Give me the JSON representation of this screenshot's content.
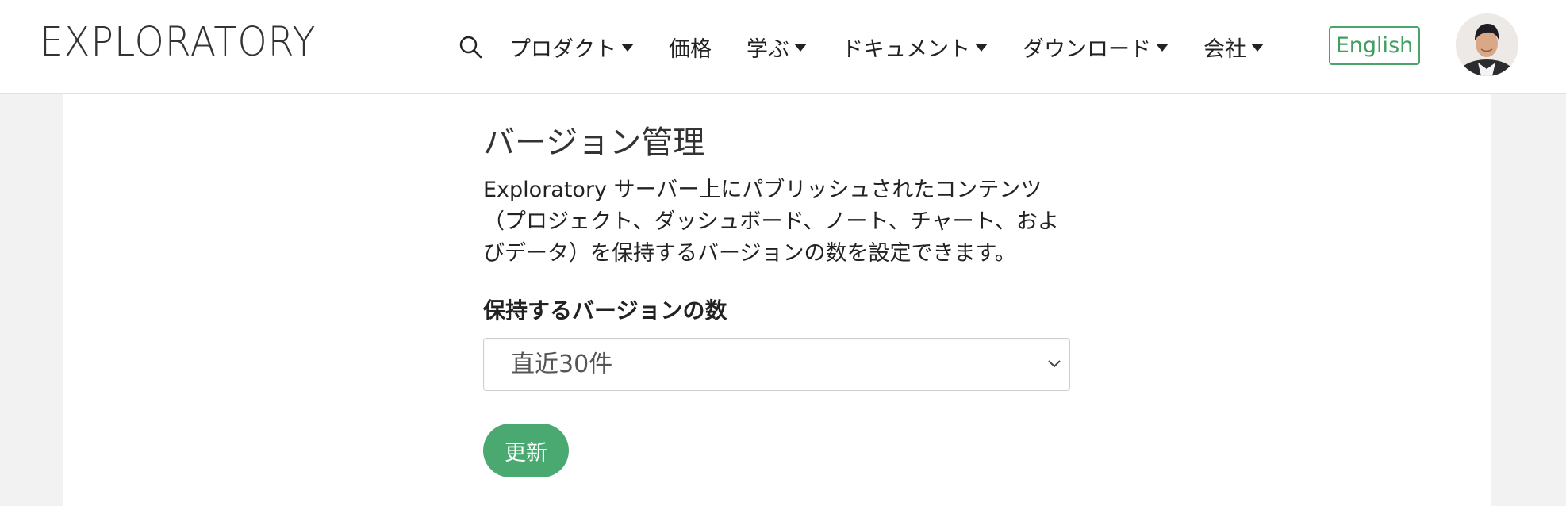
{
  "header": {
    "logo_text": "EXPLORATORY",
    "nav": [
      {
        "label": "プロダクト",
        "has_dropdown": true
      },
      {
        "label": "価格",
        "has_dropdown": false
      },
      {
        "label": "学ぶ",
        "has_dropdown": true
      },
      {
        "label": "ドキュメント",
        "has_dropdown": true
      },
      {
        "label": "ダウンロード",
        "has_dropdown": true
      },
      {
        "label": "会社",
        "has_dropdown": true
      }
    ],
    "language_button": "English",
    "icons": {
      "search": "search-icon",
      "dropdown": "caret-down-icon",
      "avatar": "user-avatar"
    }
  },
  "main": {
    "title": "バージョン管理",
    "description": "Exploratory サーバー上にパブリッシュされたコンテンツ（プロジェクト、ダッシュボード、ノート、チャート、およびデータ）を保持するバージョンの数を設定できます。",
    "field_label": "保持するバージョンの数",
    "select": {
      "value": "直近30件"
    },
    "submit_label": "更新"
  },
  "colors": {
    "accent_green": "#4aa970",
    "english_border": "#4aa56b",
    "page_background": "#f2f2f2"
  }
}
